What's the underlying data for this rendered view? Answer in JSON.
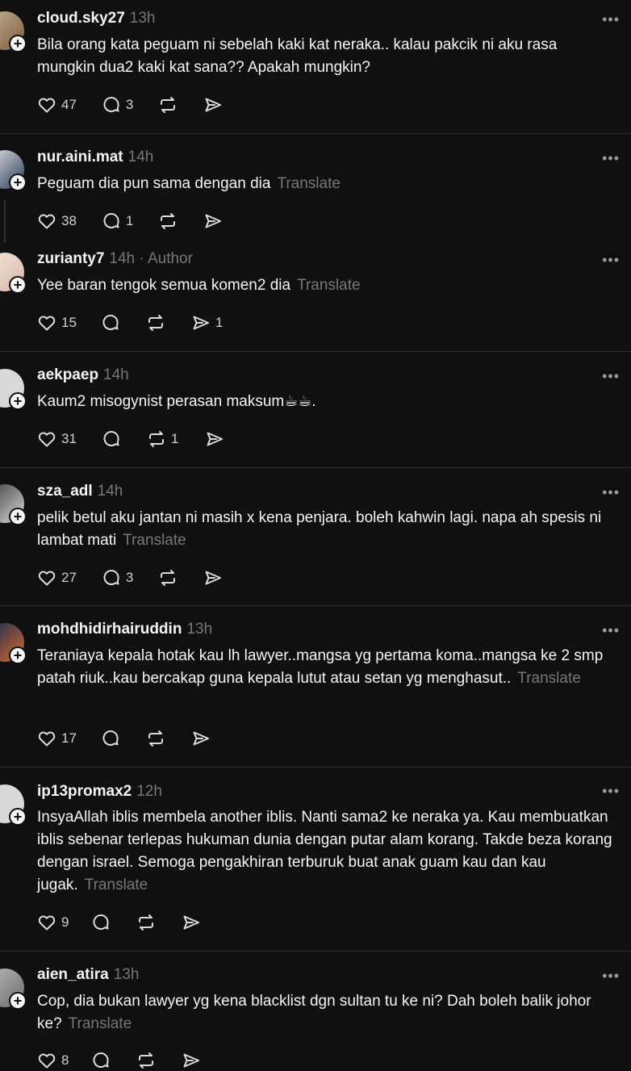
{
  "posts": [
    {
      "user": "cloud.sky27",
      "time": "13h",
      "text": "Bila orang kata peguam ni sebelah kaki kat neraka.. kalau pakcik ni aku rasa mungkin dua2 kaki kat sana?? Apakah mungkin?",
      "translate": "",
      "likes": "47",
      "replies": "3",
      "reposts": "",
      "shares": ""
    },
    {
      "user": "nur.aini.mat",
      "time": "14h",
      "text": "Peguam dia pun sama dengan dia",
      "translate": "Translate",
      "likes": "38",
      "replies": "1",
      "reposts": "",
      "shares": ""
    },
    {
      "user": "zurianty7",
      "time": "14h",
      "author": "· Author",
      "text": "Yee baran tengok semua komen2 dia",
      "translate": "Translate",
      "likes": "15",
      "replies": "",
      "reposts": "",
      "shares": "1"
    },
    {
      "user": "aekpaep",
      "time": "14h",
      "text": "Kaum2 misogynist perasan maksum☕☕.",
      "translate": "",
      "likes": "31",
      "replies": "",
      "reposts": "1",
      "shares": ""
    },
    {
      "user": "sza_adl",
      "time": "14h",
      "text": "pelik betul aku jantan ni masih x kena penjara. boleh kahwin lagi. napa ah spesis ni lambat mati",
      "translate": "Translate",
      "likes": "27",
      "replies": "3",
      "reposts": "",
      "shares": ""
    },
    {
      "user": "mohdhidirhairuddin",
      "time": "13h",
      "text": "Teraniaya kepala hotak kau lh lawyer..mangsa yg pertama koma..mangsa ke 2 smp patah riuk..kau bercakap guna kepala lutut atau setan yg menghasut..",
      "translate": "Translate",
      "likes": "17",
      "replies": "",
      "reposts": "",
      "shares": ""
    },
    {
      "user": "ip13promax2",
      "time": "12h",
      "text": "InsyaAllah iblis membela another iblis. Nanti sama2 ke neraka ya. Kau membuatkan iblis sebenar terlepas hukuman dunia dengan putar alam korang. Takde beza korang dengan israel. Semoga pengakhiran terburuk buat anak guam kau dan kau jugak.",
      "translate": "Translate",
      "likes": "9",
      "replies": "",
      "reposts": "",
      "shares": ""
    },
    {
      "user": "aien_atira",
      "time": "13h",
      "text": "Cop, dia bukan lawyer yg kena blacklist dgn sultan tu ke ni? Dah boleh balik johor ke?",
      "translate": "Translate",
      "likes": "8",
      "replies": "",
      "reposts": "",
      "shares": ""
    }
  ],
  "more_label": "•••",
  "plus_label": "+",
  "colors": {
    "background": "#101010",
    "text": "#f3f5f7",
    "muted": "#777777"
  }
}
